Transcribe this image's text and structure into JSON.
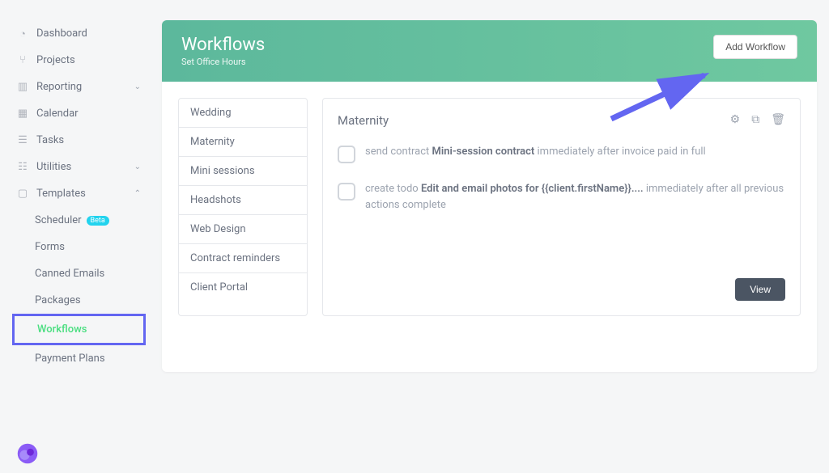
{
  "sidebar": {
    "items": [
      {
        "label": "Dashboard",
        "icon": "gauge"
      },
      {
        "label": "Projects",
        "icon": "branch"
      },
      {
        "label": "Reporting",
        "icon": "chart",
        "chevron": "down"
      },
      {
        "label": "Calendar",
        "icon": "calendar"
      },
      {
        "label": "Tasks",
        "icon": "list"
      },
      {
        "label": "Utilities",
        "icon": "stack",
        "chevron": "down"
      },
      {
        "label": "Templates",
        "icon": "doc",
        "chevron": "up"
      }
    ],
    "sub": [
      {
        "label": "Scheduler",
        "badge": "Beta"
      },
      {
        "label": "Forms"
      },
      {
        "label": "Canned Emails"
      },
      {
        "label": "Packages"
      },
      {
        "label": "Workflows",
        "active": true
      },
      {
        "label": "Payment Plans"
      }
    ]
  },
  "header": {
    "title": "Workflows",
    "subtitle": "Set Office Hours",
    "button": "Add Workflow"
  },
  "workflows": [
    "Wedding",
    "Maternity",
    "Mini sessions",
    "Headshots",
    "Web Design",
    "Contract reminders",
    "Client Portal"
  ],
  "detail": {
    "title": "Maternity",
    "steps": [
      {
        "prefix": "send contract ",
        "bold": "Mini-session contract",
        "suffix": " immediately after invoice paid in full"
      },
      {
        "prefix": "create todo ",
        "bold": "Edit and email photos for {{client.firstName}}....",
        "suffix": " immediately after all previous actions complete"
      }
    ],
    "view": "View"
  }
}
